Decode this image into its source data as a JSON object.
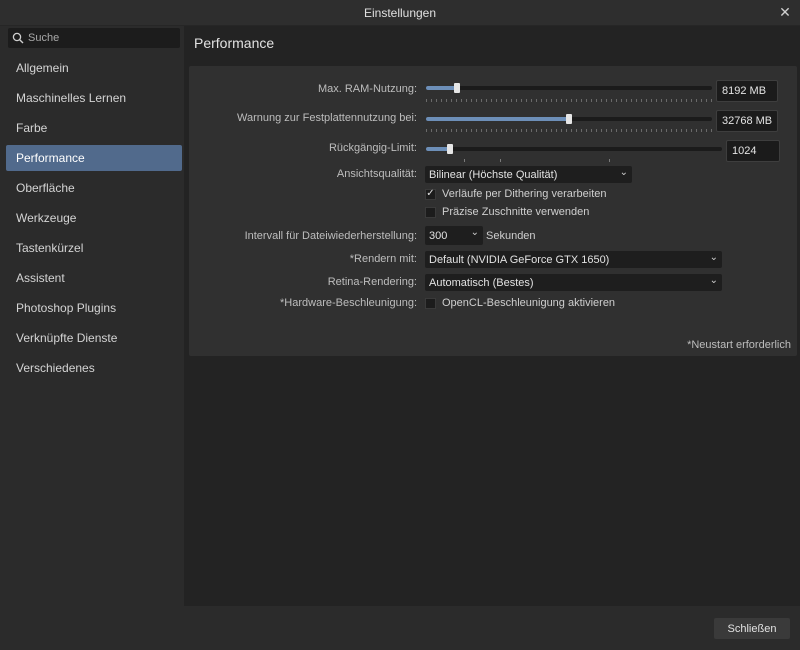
{
  "window": {
    "title": "Einstellungen"
  },
  "search": {
    "placeholder": "Suche"
  },
  "sidebar": {
    "items": [
      {
        "label": "Allgemein",
        "active": false
      },
      {
        "label": "Maschinelles Lernen",
        "active": false
      },
      {
        "label": "Farbe",
        "active": false
      },
      {
        "label": "Performance",
        "active": true
      },
      {
        "label": "Oberfläche",
        "active": false
      },
      {
        "label": "Werkzeuge",
        "active": false
      },
      {
        "label": "Tastenkürzel",
        "active": false
      },
      {
        "label": "Assistent",
        "active": false
      },
      {
        "label": "Photoshop Plugins",
        "active": false
      },
      {
        "label": "Verknüpfte Dienste",
        "active": false
      },
      {
        "label": "Verschiedenes",
        "active": false
      }
    ]
  },
  "page": {
    "title": "Performance"
  },
  "settings": {
    "ram": {
      "label": "Max. RAM-Nutzung:",
      "value": "8192 MB",
      "level": 0.11
    },
    "disk_warning": {
      "label": "Warnung zur Festplattennutzung bei:",
      "value": "32768 MB",
      "level": 0.5
    },
    "undo_limit": {
      "label": "Rückgängig-Limit:",
      "value": "1024",
      "level": 0.08
    },
    "view_quality": {
      "label": "Ansichtsqualität:",
      "value": "Bilinear (Höchste Qualität)"
    },
    "dithering": {
      "label": "Verläufe per Dithering verarbeiten",
      "checked": true
    },
    "precise_clipping": {
      "label": "Präzise Zuschnitte verwenden",
      "checked": false
    },
    "recovery_interval": {
      "label": "Intervall für Dateiwiederherstellung:",
      "value": "300",
      "unit": "Sekunden"
    },
    "render_with": {
      "label": "*Rendern mit:",
      "value": "Default (NVIDIA GeForce GTX 1650)"
    },
    "retina": {
      "label": "Retina-Rendering:",
      "value": "Automatisch (Bestes)"
    },
    "hw_accel": {
      "label": "*Hardware-Beschleunigung:",
      "option": "OpenCL-Beschleunigung aktivieren",
      "checked": false
    }
  },
  "note": "*Neustart erforderlich",
  "footer": {
    "close_label": "Schließen"
  },
  "colors": {
    "accent": "#516a8c",
    "slider_fill": "#6d8fb8"
  }
}
